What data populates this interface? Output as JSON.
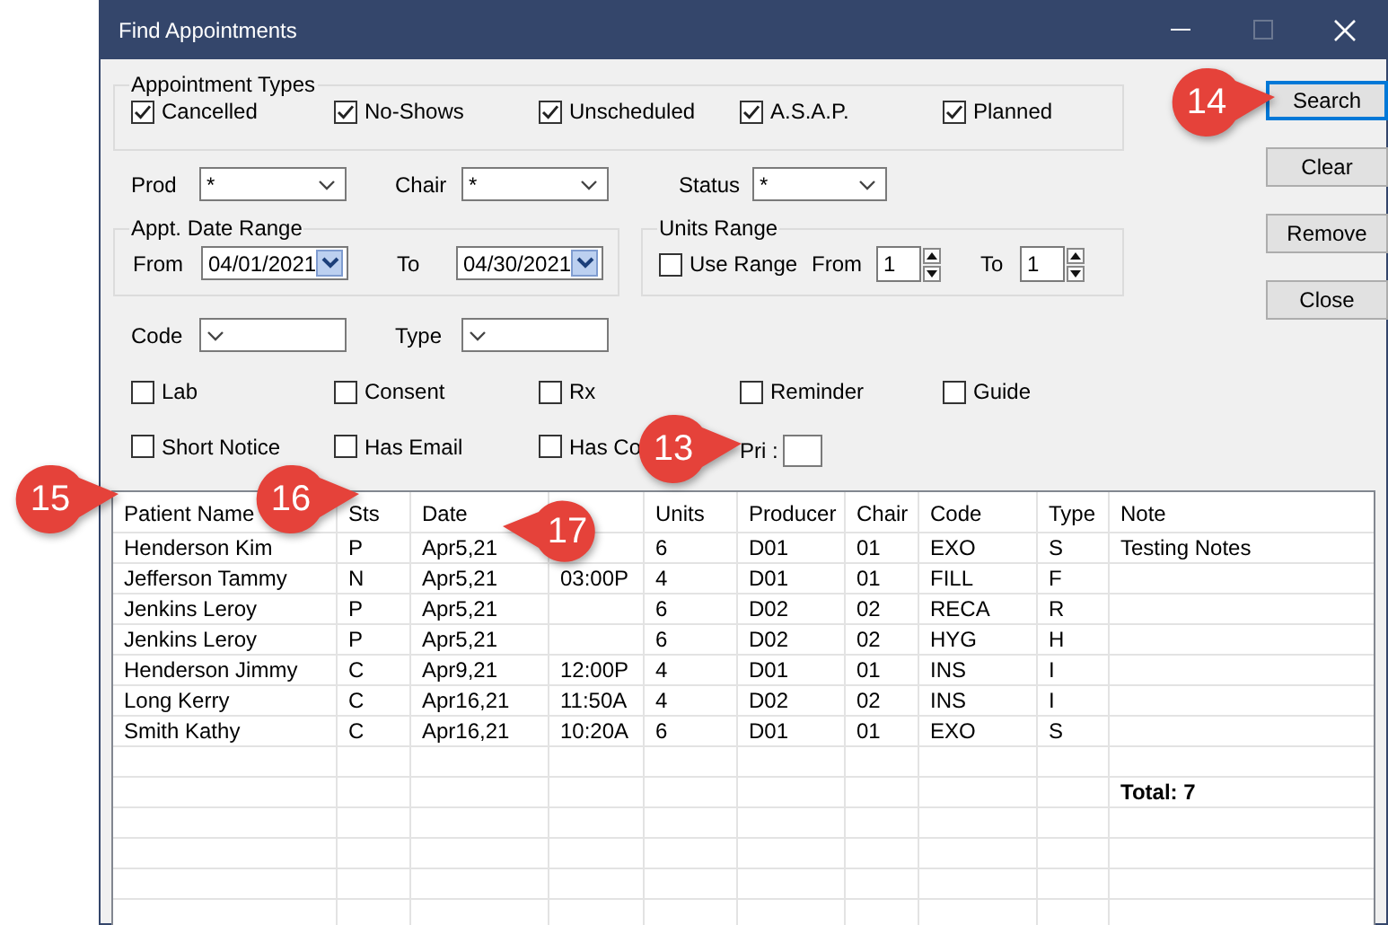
{
  "window": {
    "title": "Find Appointments",
    "controls": [
      {
        "kind": "minimize",
        "disabled": false
      },
      {
        "kind": "maximize",
        "disabled": true
      },
      {
        "kind": "close",
        "disabled": false
      }
    ]
  },
  "appointment_types": {
    "title": "Appointment Types",
    "options": [
      {
        "label": "Cancelled",
        "checked": true
      },
      {
        "label": "No-Shows",
        "checked": true
      },
      {
        "label": "Unscheduled",
        "checked": true
      },
      {
        "label": "A.S.A.P.",
        "checked": true
      },
      {
        "label": "Planned",
        "checked": true
      }
    ]
  },
  "filters": [
    {
      "label": "Prod",
      "value": "*"
    },
    {
      "label": "Chair",
      "value": "*"
    },
    {
      "label": "Status",
      "value": "*"
    }
  ],
  "date_range": {
    "title": "Appt. Date Range",
    "from_label": "From",
    "from": "04/01/2021",
    "to_label": "To",
    "to": "04/30/2021"
  },
  "units_range": {
    "title": "Units Range",
    "use_range": {
      "label": "Use Range",
      "checked": false
    },
    "from_label": "From",
    "from": "1",
    "to_label": "To",
    "to": "1"
  },
  "code_filters": [
    {
      "label": "Code"
    },
    {
      "label": "Type"
    }
  ],
  "flags": [
    {
      "label": "Lab",
      "checked": false
    },
    {
      "label": "Consent",
      "checked": false
    },
    {
      "label": "Rx",
      "checked": false
    },
    {
      "label": "Reminder",
      "checked": false
    },
    {
      "label": "Guide",
      "checked": false
    },
    {
      "label": "Short Notice",
      "checked": false
    },
    {
      "label": "Has Email",
      "checked": false
    },
    {
      "label": "Has Co",
      "checked": false
    }
  ],
  "priority": {
    "label": "Pri :"
  },
  "buttons": [
    {
      "label": "Search",
      "default": true
    },
    {
      "label": "Clear",
      "default": false
    },
    {
      "label": "Remove",
      "default": false
    },
    {
      "label": "Close",
      "default": false
    }
  ],
  "table": {
    "columns": [
      "Patient Name",
      "Sts",
      "Date",
      null,
      "Units",
      "Producer",
      "Chair",
      "Code",
      "Type",
      "Note"
    ],
    "rows": [
      [
        "Henderson Kim",
        "P",
        "Apr5,21",
        null,
        "6",
        "D01",
        "01",
        "EXO",
        "S",
        "Testing Notes"
      ],
      [
        "Jefferson Tammy",
        "N",
        "Apr5,21",
        "03:00P",
        "4",
        "D01",
        "01",
        "FILL",
        "F",
        null
      ],
      [
        "Jenkins Leroy",
        "P",
        "Apr5,21",
        null,
        "6",
        "D02",
        "02",
        "RECA",
        "R",
        null
      ],
      [
        "Jenkins Leroy",
        "P",
        "Apr5,21",
        null,
        "6",
        "D02",
        "02",
        "HYG",
        "H",
        null
      ],
      [
        "Henderson Jimmy",
        "C",
        "Apr9,21",
        "12:00P",
        "4",
        "D01",
        "01",
        "INS",
        "I",
        null
      ],
      [
        "Long Kerry",
        "C",
        "Apr16,21",
        "11:50A",
        "4",
        "D02",
        "02",
        "INS",
        "I",
        null
      ],
      [
        "Smith Kathy",
        "C",
        "Apr16,21",
        "10:20A",
        "6",
        "D01",
        "01",
        "EXO",
        "S",
        null
      ]
    ],
    "total": "Total: 7"
  },
  "callouts": [
    {
      "number": "14",
      "kind": "right"
    },
    {
      "number": "13",
      "kind": "right"
    },
    {
      "number": "15",
      "kind": "right"
    },
    {
      "number": "16",
      "kind": "right"
    },
    {
      "number": "17",
      "kind": "left"
    }
  ]
}
